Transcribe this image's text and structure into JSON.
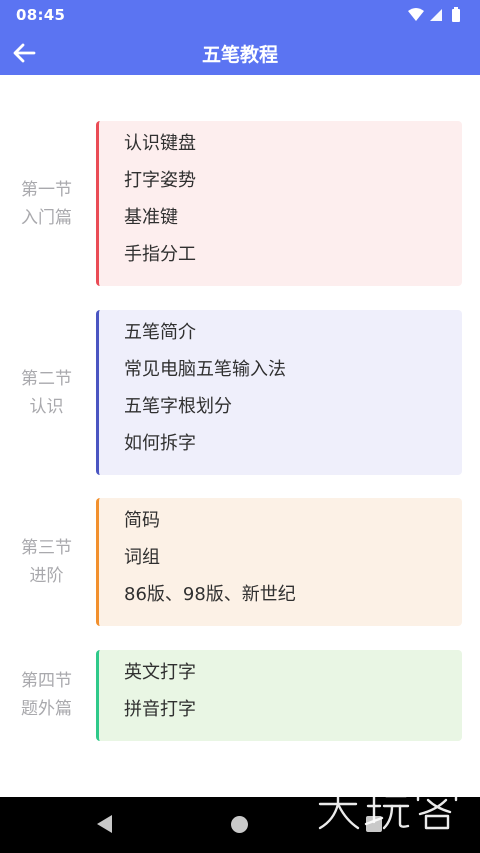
{
  "status_bar": {
    "time": "08:45",
    "icons": [
      "wifi-icon",
      "signal-icon",
      "battery-icon"
    ]
  },
  "app_bar": {
    "title": "五笔教程",
    "back_icon": "arrow-left-icon",
    "color": "#5b74f2"
  },
  "sections": [
    {
      "label_line1": "第一节",
      "label_line2": "入门篇",
      "accent": "#ea4b55",
      "items": [
        "认识键盘",
        "打字姿势",
        "基准键",
        "手指分工"
      ]
    },
    {
      "label_line1": "第二节",
      "label_line2": "认识",
      "accent": "#4a55c2",
      "items": [
        "五笔简介",
        "常见电脑五笔输入法",
        "五笔字根划分",
        "如何拆字"
      ]
    },
    {
      "label_line1": "第三节",
      "label_line2": "进阶",
      "accent": "#f2902d",
      "items": [
        "简码",
        "词组",
        "86版、98版、新世纪"
      ]
    },
    {
      "label_line1": "第四节",
      "label_line2": "题外篇",
      "accent": "#2ec98a",
      "items": [
        "英文打字",
        "拼音打字"
      ]
    }
  ],
  "watermark": {
    "text": "大玩客"
  },
  "nav_bar": {
    "icons": [
      "nav-back-icon",
      "nav-home-icon",
      "nav-recent-icon"
    ]
  }
}
